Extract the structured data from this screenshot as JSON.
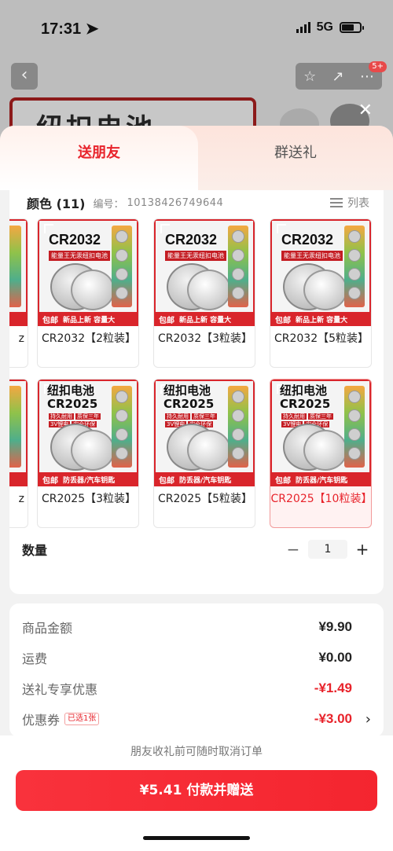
{
  "status_bar": {
    "time": "17:31",
    "network": "5G"
  },
  "background": {
    "banner_text": "纽扣电池",
    "badge": "5+"
  },
  "tabs": [
    {
      "label": "送朋友",
      "active": true
    },
    {
      "label": "群送礼",
      "active": false
    }
  ],
  "color_section": {
    "title": "颜色 (11)",
    "sku_label": "编号：",
    "sku_value": "10138426749644",
    "list_toggle_label": "列表"
  },
  "products": [
    {
      "model": "CR2032",
      "label": "CR2032【2粒装】",
      "tag": "包邮",
      "slogan": "新品上新  容量大",
      "selected": false
    },
    {
      "model": "CR2032",
      "label": "CR2032【3粒装】",
      "tag": "包邮",
      "slogan": "新品上新  容量大",
      "selected": false
    },
    {
      "model": "CR2032",
      "label": "CR2032【5粒装】",
      "tag": "包邮",
      "slogan": "新品上新  容量大",
      "selected": false
    },
    {
      "model": "CR2025",
      "label": "CR2025【3粒装】",
      "tag": "包邮",
      "slogan": "防丢器/汽车钥匙",
      "selected": false
    },
    {
      "model": "CR2025",
      "label": "CR2025【5粒装】",
      "tag": "包邮",
      "slogan": "防丢器/汽车钥匙",
      "selected": false
    },
    {
      "model": "CR2025",
      "label": "CR2025【10粒装】",
      "tag": "包邮",
      "slogan": "防丢器/汽车钥匙",
      "selected": true
    }
  ],
  "product_image_text": {
    "cr2032_sub": "能量王无汞纽扣电池",
    "cr2025_title": "纽扣电池",
    "cr2025_tags": [
      "持久耐用",
      "质保三年",
      "3V锂电",
      "安全环保"
    ],
    "partial_left_label": "z"
  },
  "quantity": {
    "label": "数量",
    "value": "1",
    "minus": "−",
    "plus": "+"
  },
  "summary": {
    "rows": [
      {
        "label": "商品金额",
        "value": "¥9.90"
      },
      {
        "label": "运费",
        "value": "¥0.00"
      },
      {
        "label": "送礼专享优惠",
        "value": "-¥1.49"
      },
      {
        "label": "优惠券",
        "value": "-¥3.00",
        "tag": "已选1张"
      }
    ]
  },
  "footer": {
    "note": "朋友收礼前可随时取消订单",
    "pay_button": "¥5.41 付款并赠送"
  },
  "colors": {
    "accent": "#e8232b",
    "button": "#f4252f"
  }
}
